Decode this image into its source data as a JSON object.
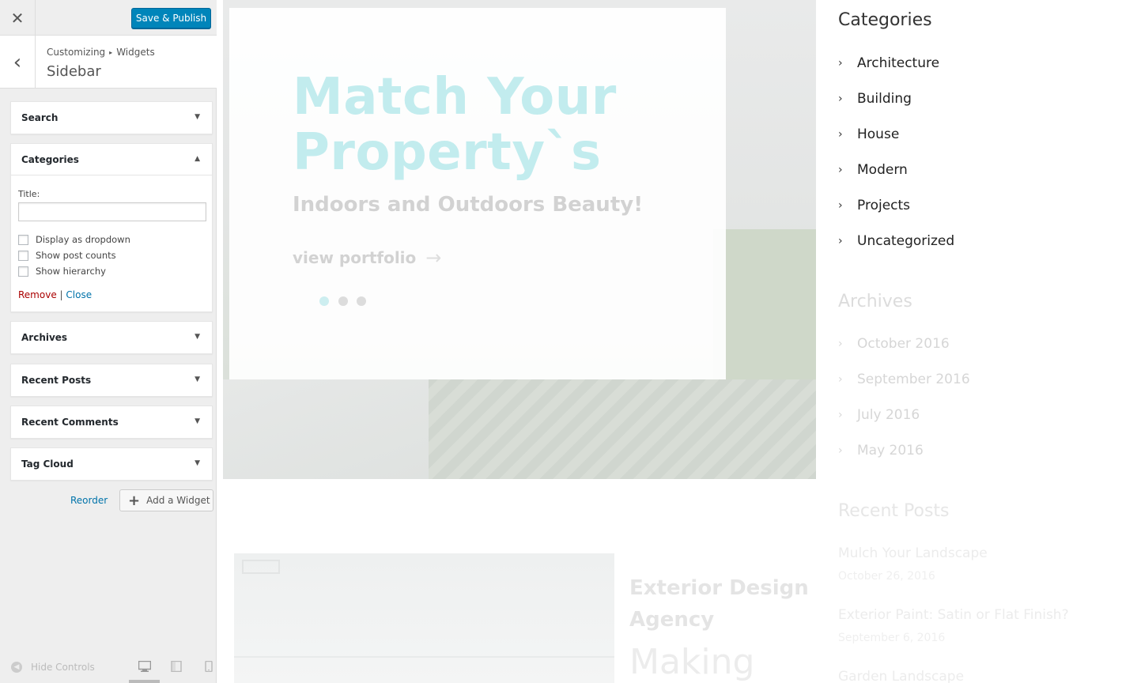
{
  "customizer": {
    "close_glyph": "✕",
    "save_label": "Save & Publish",
    "back_glyph": "‹",
    "breadcrumb": {
      "root": "Customizing",
      "sep": "▸",
      "current": "Widgets"
    },
    "section_title": "Sidebar",
    "widgets": [
      {
        "title": "Search",
        "arrow": "▼"
      },
      {
        "title": "Categories",
        "arrow": "▲"
      },
      {
        "title": "Archives",
        "arrow": "▼"
      },
      {
        "title": "Recent Posts",
        "arrow": "▼"
      },
      {
        "title": "Recent Comments",
        "arrow": "▼"
      },
      {
        "title": "Tag Cloud",
        "arrow": "▼"
      }
    ],
    "categories_form": {
      "title_label": "Title:",
      "title_value": "",
      "options": [
        {
          "label": "Display as dropdown",
          "checked": false
        },
        {
          "label": "Show post counts",
          "checked": false
        },
        {
          "label": "Show hierarchy",
          "checked": false
        }
      ],
      "remove_label": "Remove",
      "divider": "|",
      "close_label": "Close"
    },
    "reorder_label": "Reorder",
    "add_widget": {
      "plus": "+",
      "label": "Add a Widget"
    },
    "hide_controls_label": "Hide Controls",
    "devices": [
      "desktop-icon",
      "tablet-icon",
      "mobile-icon"
    ]
  },
  "preview": {
    "hero": {
      "title_line1": "Match Your",
      "title_line2": "Property`s",
      "subtitle": "Indoors and Outdoors Beauty!",
      "button_label": "view portfolio",
      "button_arrow": "→",
      "slides": 3,
      "active_slide": 1
    },
    "card": {
      "title": "Exterior Design Agency",
      "subheading": "Making"
    },
    "sidebar": {
      "categories_title": "Categories",
      "categories": [
        "Architecture",
        "Building",
        "House",
        "Modern",
        "Projects",
        "Uncategorized"
      ],
      "archives_title": "Archives",
      "archives": [
        "October 2016",
        "September 2016",
        "July 2016",
        "May 2016"
      ],
      "recent_posts_title": "Recent Posts",
      "recent_posts": [
        {
          "title": "Mulch Your Landscape",
          "date": "October 26, 2016"
        },
        {
          "title": "Exterior Paint: Satin or Flat Finish?",
          "date": "September 6, 2016"
        },
        {
          "title": "Garden Landscape",
          "date": ""
        }
      ],
      "chevron": "›"
    }
  },
  "colors": {
    "primary_button": "#0085ba",
    "link": "#0073aa",
    "remove_link": "#a00000",
    "hero_title": "#c2ecee"
  }
}
